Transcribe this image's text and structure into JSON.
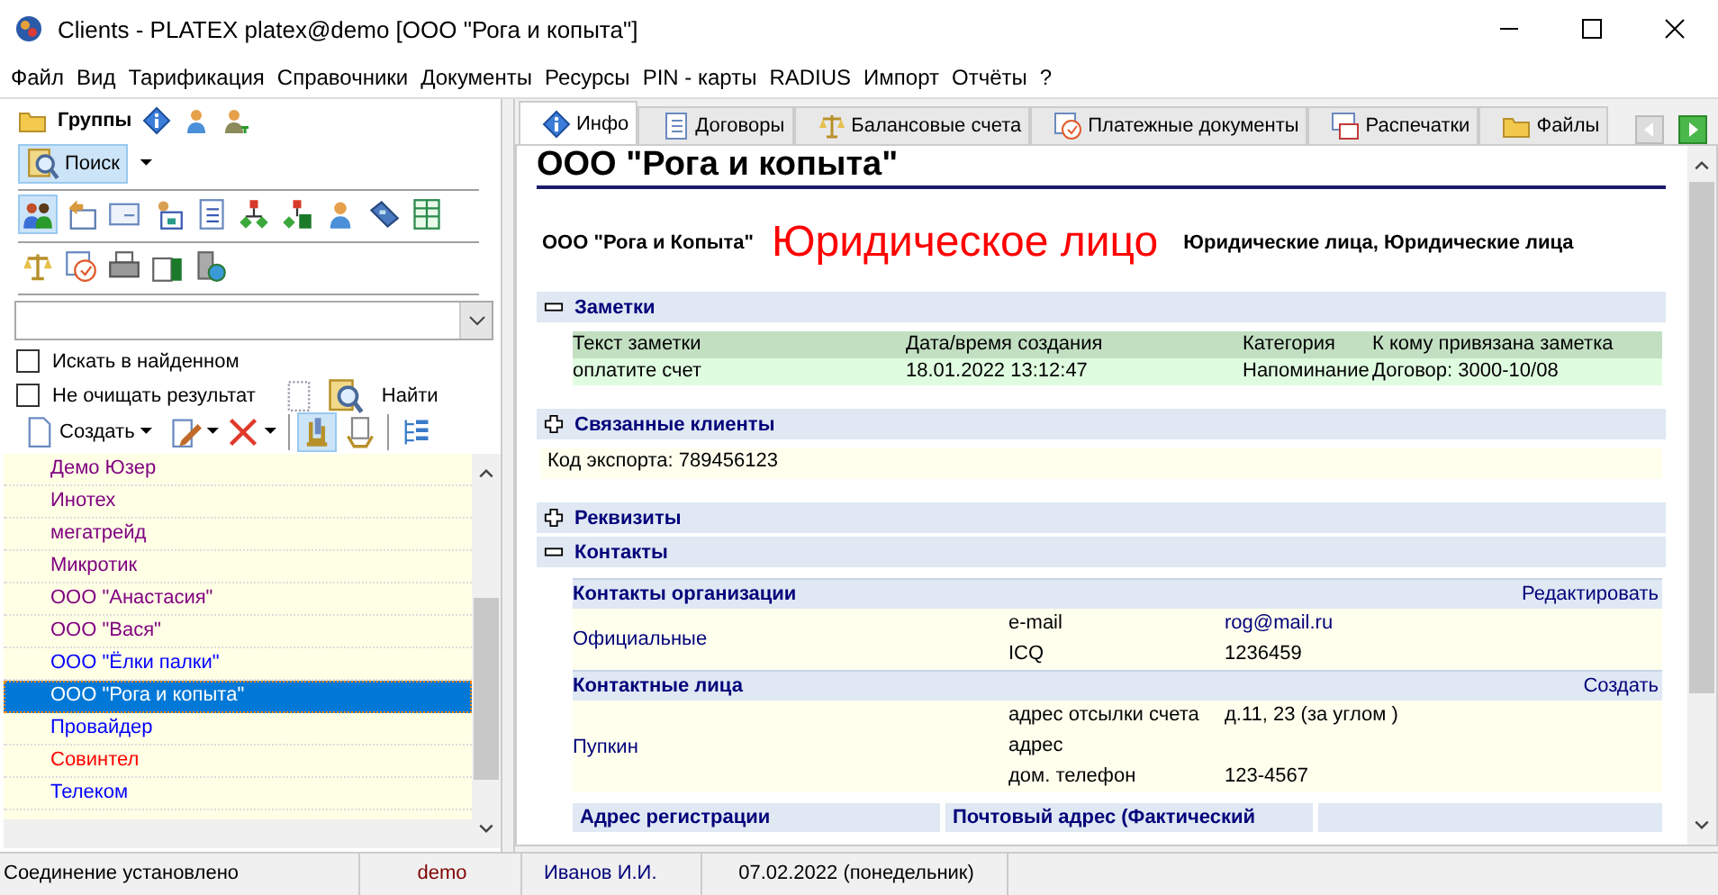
{
  "window": {
    "title": "Clients - PLATEX platex@demo [ООО \"Рога и копыта\"]"
  },
  "menu": [
    "Файл",
    "Вид",
    "Тарификация",
    "Справочники",
    "Документы",
    "Ресурсы",
    "PIN - карты",
    "RADIUS",
    "Импорт",
    "Отчёты",
    "?"
  ],
  "left_panel": {
    "groups_label": "Группы",
    "search_button": "Поиск",
    "checkboxes": [
      {
        "label": "Искать в найденном",
        "checked": false
      },
      {
        "label": "Не очищать результат",
        "checked": false
      }
    ],
    "find_button": "Найти",
    "create_button": "Создать",
    "clients": [
      {
        "name": "Демо Юзер",
        "color": "#800080",
        "selected": false
      },
      {
        "name": "Инотех",
        "color": "#800080",
        "selected": false
      },
      {
        "name": "мегатрейд",
        "color": "#800080",
        "selected": false
      },
      {
        "name": "Микротик",
        "color": "#800080",
        "selected": false
      },
      {
        "name": "ООО \"Анастасия\"",
        "color": "#800080",
        "selected": false
      },
      {
        "name": "ООО \"Вася\"",
        "color": "#800080",
        "selected": false
      },
      {
        "name": "ООО \"Ёлки палки\"",
        "color": "#0000ff",
        "selected": false
      },
      {
        "name": "ООО \"Рога и копыта\"",
        "selected": true
      },
      {
        "name": "Провайдер",
        "color": "#0000ff",
        "selected": false
      },
      {
        "name": "Совинтел",
        "color": "#ff0000",
        "selected": false
      },
      {
        "name": "Телеком",
        "color": "#0000ff",
        "selected": false
      }
    ]
  },
  "tabs": [
    {
      "label": "Инфо",
      "selected": true
    },
    {
      "label": "Договоры",
      "selected": false
    },
    {
      "label": "Балансовые счета",
      "selected": false
    },
    {
      "label": "Платежные документы",
      "selected": false
    },
    {
      "label": "Распечатки",
      "selected": false
    },
    {
      "label": "Файлы",
      "selected": false
    }
  ],
  "client": {
    "heading": "ООО \"Рога и копыта\"",
    "name": "ООО \"Рога и Копыта\"",
    "type": "Юридическое лицо",
    "groups": "Юридические лица, Юридические лица"
  },
  "sections": [
    {
      "kind": "notes",
      "title": "Заметки",
      "expanded": true,
      "columns": [
        "Текст заметки",
        "Дата/время создания",
        "Категория",
        "К кому привязана заметка"
      ],
      "rows": [
        [
          "оплатите счет",
          "18.01.2022 13:12:47",
          "Напоминание",
          "Договор: 3000-10/08"
        ]
      ]
    },
    {
      "kind": "header",
      "title": "Связанные клиенты",
      "expanded": false
    },
    {
      "kind": "info",
      "text": "Код экспорта: 789456123"
    },
    {
      "kind": "header",
      "title": "Реквизиты",
      "expanded": false
    },
    {
      "kind": "contacts",
      "title": "Контакты",
      "expanded": true,
      "groups": [
        {
          "title": "Контакты организации",
          "action": "Редактировать",
          "name": "Официальные",
          "entries": [
            {
              "label": "e-mail",
              "value": "rog@mail.ru",
              "link": true
            },
            {
              "label": "ICQ",
              "value": "1236459",
              "link": false
            }
          ]
        },
        {
          "title": "Контактные лица",
          "action": "Создать",
          "name": "Пупкин",
          "entries": [
            {
              "label": "адрес отсылки счета",
              "value": "д.11, 23 (за углом )",
              "link": false
            },
            {
              "label": "адрес"
            },
            {
              "label": "дом. телефон",
              "value": "123-4567",
              "link": false
            }
          ]
        }
      ],
      "address_columns": [
        "Адрес регистрации",
        "Почтовый адрес (Фактический"
      ]
    }
  ],
  "status_bar": [
    {
      "text": "Соединение установлено",
      "kind": "plain"
    },
    {
      "text": "demo",
      "kind": "user"
    },
    {
      "text": "Иванов И.И.",
      "kind": "name"
    },
    {
      "text": "07.02.2022 (понедельник)",
      "kind": "plain"
    }
  ]
}
